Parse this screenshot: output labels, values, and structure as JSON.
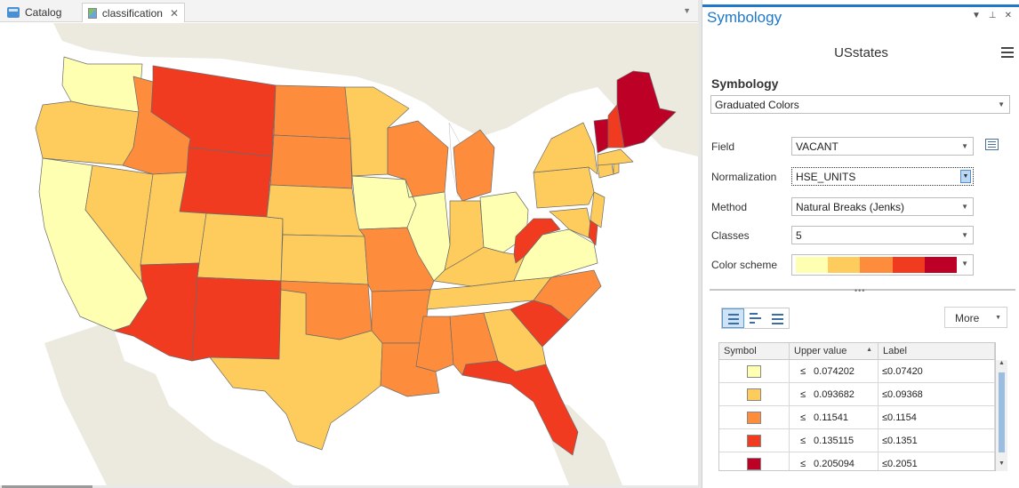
{
  "tabs": [
    {
      "label": "Catalog",
      "icon": "catalog-icon"
    },
    {
      "label": "classification",
      "icon": "map-icon",
      "close": "✕"
    }
  ],
  "map": {
    "classes": [
      {
        "color": "#ffffb2",
        "states": [
          "WA",
          "CA",
          "IA",
          "IL",
          "OH",
          "VA"
        ]
      },
      {
        "color": "#fecc5c",
        "states": [
          "OR",
          "NV",
          "UT",
          "CO",
          "MN",
          "NE",
          "KS",
          "NY",
          "PA",
          "NJ",
          "KY",
          "TN",
          "IN",
          "TX",
          "GA",
          "MD",
          "CT",
          "RI",
          "MA"
        ]
      },
      {
        "color": "#fd8d3c",
        "states": [
          "ID",
          "ND",
          "SD",
          "WI",
          "MI",
          "MO",
          "OK",
          "AR",
          "LA",
          "MS",
          "AL",
          "NC"
        ]
      },
      {
        "color": "#f03b20",
        "states": [
          "MT",
          "WY",
          "AZ",
          "NM",
          "WV",
          "SC",
          "FL",
          "DE",
          "NH"
        ]
      },
      {
        "color": "#bd0026",
        "states": [
          "ME",
          "VT"
        ]
      }
    ]
  },
  "pane": {
    "title": "Symbology",
    "layer": "USstates",
    "section": "Symbology",
    "renderer": "Graduated Colors",
    "field_label": "Field",
    "field_value": "VACANT",
    "normalization_label": "Normalization",
    "normalization_value": "HSE_UNITS",
    "method_label": "Method",
    "method_value": "Natural Breaks (Jenks)",
    "classes_label": "Classes",
    "classes_value": "5",
    "scheme_label": "Color scheme",
    "scheme_colors": [
      "#ffffb2",
      "#fecc5c",
      "#fd8d3c",
      "#f03b20",
      "#bd0026"
    ],
    "more_label": "More",
    "table": {
      "headers": [
        "Symbol",
        "Upper value",
        "Label"
      ],
      "rows": [
        {
          "color": "#ffffb2",
          "op": "≤",
          "upper": "0.074202",
          "label": "≤0.07420"
        },
        {
          "color": "#fecc5c",
          "op": "≤",
          "upper": "0.093682",
          "label": "≤0.09368"
        },
        {
          "color": "#fd8d3c",
          "op": "≤",
          "upper": "0.11541",
          "label": "≤0.1154"
        },
        {
          "color": "#f03b20",
          "op": "≤",
          "upper": "0.135115",
          "label": "≤0.1351"
        },
        {
          "color": "#bd0026",
          "op": "≤",
          "upper": "0.205094",
          "label": "≤0.2051"
        }
      ]
    }
  }
}
